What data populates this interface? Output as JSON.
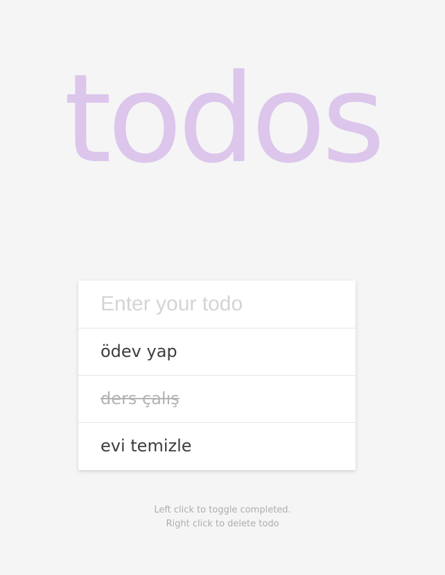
{
  "header": {
    "title": "todos"
  },
  "input": {
    "placeholder": "Enter your todo",
    "value": ""
  },
  "todos": [
    {
      "text": "ödev yap",
      "completed": false
    },
    {
      "text": "ders çalış",
      "completed": true
    },
    {
      "text": "evi temizle",
      "completed": false
    }
  ],
  "footer": {
    "line1": "Left click to toggle completed.",
    "line2": "Right click to delete todo"
  },
  "colors": {
    "title": "#dcc6ec",
    "background": "#f5f5f5",
    "completed_text": "#b3b3b3",
    "active_text": "#3d3d3d"
  }
}
